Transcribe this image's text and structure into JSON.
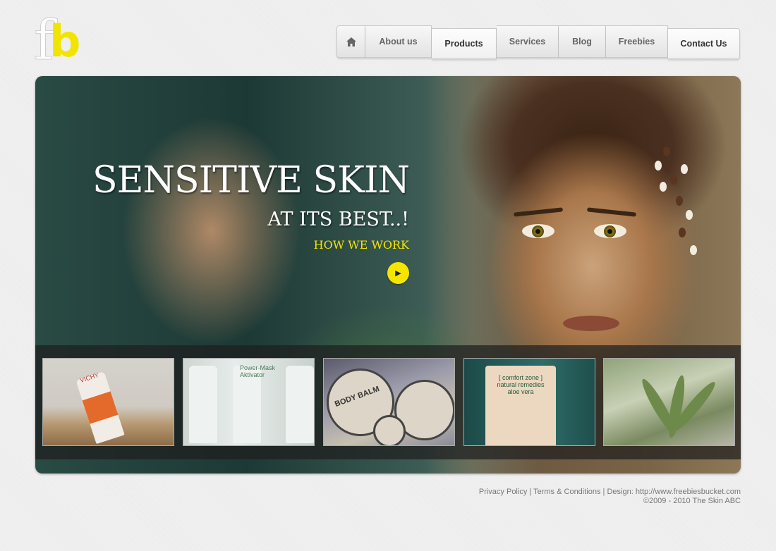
{
  "logo": {
    "text": "fb",
    "colors": {
      "f": "#ffffff",
      "b": "#f0e400"
    }
  },
  "nav": {
    "home_icon": "home-icon",
    "items": [
      {
        "label": "About us",
        "active": false
      },
      {
        "label": "Products",
        "active": true
      },
      {
        "label": "Services",
        "active": false
      },
      {
        "label": "Blog",
        "active": false
      },
      {
        "label": "Freebies",
        "active": false
      },
      {
        "label": "Contact Us",
        "active": true
      }
    ]
  },
  "hero": {
    "title": "SENSITIVE SKIN",
    "subtitle": "AT ITS BEST..!",
    "link": "HOW WE WORK",
    "play_icon": "play-icon",
    "accent_color": "#f5e600"
  },
  "thumbnails": [
    {
      "caption": "VICHY"
    },
    {
      "caption": "Power-Mask Aktivator"
    },
    {
      "caption": "BODY BALM"
    },
    {
      "caption": "[ comfort zone ] natural remedies aloe vera"
    },
    {
      "caption": ""
    }
  ],
  "footer": {
    "privacy": "Privacy Policy",
    "sep1": " | ",
    "terms": "Terms & Conditions",
    "sep2": " | ",
    "design": "Design: http://www.freebiesbucket.com",
    "copyright": "©2009 - 2010 The Skin ABC"
  }
}
